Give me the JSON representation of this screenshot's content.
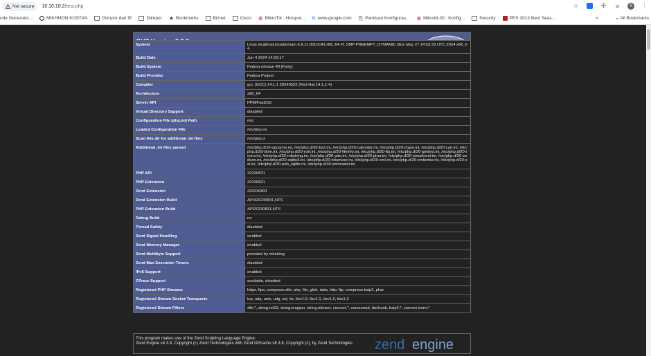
{
  "browser": {
    "security_label": "Not secure",
    "url_host": "10.10.10.2",
    "url_path": "/test.php",
    "bookmarks": [
      {
        "label": "ode Generator...",
        "icon": "page-icon"
      },
      {
        "label": "MIKHMON KOSTAN",
        "icon": "globe-icon"
      },
      {
        "label": "Diimpor dari IE",
        "icon": "folder-icon"
      },
      {
        "label": "Diimpor",
        "icon": "folder-icon"
      },
      {
        "label": "Bookmarks",
        "icon": "star-icon"
      },
      {
        "label": "Biznet",
        "icon": "folder-icon"
      },
      {
        "label": "Cisco",
        "icon": "folder-icon"
      },
      {
        "label": "MikroTik - Hotspot...",
        "icon": "mikrotik-icon"
      },
      {
        "label": "www.google.com",
        "icon": "google-icon"
      },
      {
        "label": "Panduan Konfiguras...",
        "icon": "page-icon"
      },
      {
        "label": "Mikrotik.ID : Konfig...",
        "icon": "mikrotik-icon"
      },
      {
        "label": "Security",
        "icon": "folder-icon"
      },
      {
        "label": "PES 2013 Next Seas...",
        "icon": "pes-icon"
      }
    ],
    "more_bookmarks": "»",
    "all_bookmarks": "All Bookmarks",
    "avatar_letter": "A"
  },
  "header": {
    "title": "PHP Version 8.3.8",
    "logo_text": "php"
  },
  "rows": [
    {
      "key": "System",
      "value": "Linux localhost.localdomain 6.8.11-300.fc40.x86_64 #1 SMP PREEMPT_DYNAMIC Mon May 27 14:53:33 UTC 2024 x86_64"
    },
    {
      "key": "Build Date",
      "value": "Jun 4 2024 14:53:17"
    },
    {
      "key": "Build System",
      "value": "Fedora release 40 (Forty)"
    },
    {
      "key": "Build Provider",
      "value": "Fedora Project"
    },
    {
      "key": "Compiler",
      "value": "gcc (GCC) 14.1.1 20240522 (Red Hat 14.1.1-4)"
    },
    {
      "key": "Architecture",
      "value": "x86_64"
    },
    {
      "key": "Server API",
      "value": "FPM/FastCGI"
    },
    {
      "key": "Virtual Directory Support",
      "value": "disabled"
    },
    {
      "key": "Configuration File (php.ini) Path",
      "value": "/etc"
    },
    {
      "key": "Loaded Configuration File",
      "value": "/etc/php.ini"
    },
    {
      "key": "Scan this dir for additional .ini files",
      "value": "/etc/php.d"
    },
    {
      "key": "Additional .ini files parsed",
      "value": "/etc/php.d/10-opcache.ini, /etc/php.d/20-bz2.ini, /etc/php.d/20-calendar.ini, /etc/php.d/20-ctype.ini, /etc/php.d/20-curl.ini, /etc/php.d/20-dom.ini, /etc/php.d/20-exif.ini, /etc/php.d/20-fileinfo.ini, /etc/php.d/20-ftp.ini, /etc/php.d/20-gettext.ini, /etc/php.d/20-iconv.ini, /etc/php.d/20-mbstring.ini, /etc/php.d/20-pdo.ini, /etc/php.d/20-phar.ini, /etc/php.d/20-simplexml.ini, /etc/php.d/20-sodium.ini, /etc/php.d/20-sqlite3.ini, /etc/php.d/20-tokenizer.ini, /etc/php.d/20-xml.ini, /etc/php.d/20-xmlwriter.ini, /etc/php.d/20-xsl.ini, /etc/php.d/30-pdo_sqlite.ini, /etc/php.d/30-xmlreader.ini"
    },
    {
      "key": "PHP API",
      "value": "20230831"
    },
    {
      "key": "PHP Extension",
      "value": "20230831"
    },
    {
      "key": "Zend Extension",
      "value": "420230831"
    },
    {
      "key": "Zend Extension Build",
      "value": "API420230831,NTS"
    },
    {
      "key": "PHP Extension Build",
      "value": "API20230831,NTS"
    },
    {
      "key": "Debug Build",
      "value": "no"
    },
    {
      "key": "Thread Safety",
      "value": "disabled"
    },
    {
      "key": "Zend Signal Handling",
      "value": "enabled"
    },
    {
      "key": "Zend Memory Manager",
      "value": "enabled"
    },
    {
      "key": "Zend Multibyte Support",
      "value": "provided by mbstring"
    },
    {
      "key": "Zend Max Execution Timers",
      "value": "disabled"
    },
    {
      "key": "IPv6 Support",
      "value": "enabled"
    },
    {
      "key": "DTrace Support",
      "value": "available, disabled"
    },
    {
      "key": "Registered PHP Streams",
      "value": "https, ftps, compress.zlib, php, file, glob, data, http, ftp, compress.bzip2, phar"
    },
    {
      "key": "Registered Stream Socket Transports",
      "value": "tcp, udp, unix, udg, ssl, tls, tlsv1.0, tlsv1.1, tlsv1.2, tlsv1.3"
    },
    {
      "key": "Registered Stream Filters",
      "value": "zlib.*, string.rot13, string.toupper, string.tolower, convert.*, consumed, dechunk, bzip2.*, convert.iconv.*"
    }
  ],
  "footer": {
    "line1": "This program makes use of the Zend Scripting Language Engine:",
    "line2": "Zend Engine v4.3.8, Copyright (c) Zend Technologies with Zend OPcache v8.3.8, Copyright (c), by Zend Technologies",
    "logo_text_left": "zend",
    "logo_text_right": "engine"
  },
  "colors": {
    "header_bg": "#4f5b93",
    "page_bg": "#222222",
    "key_bg": "#4f5b93"
  }
}
